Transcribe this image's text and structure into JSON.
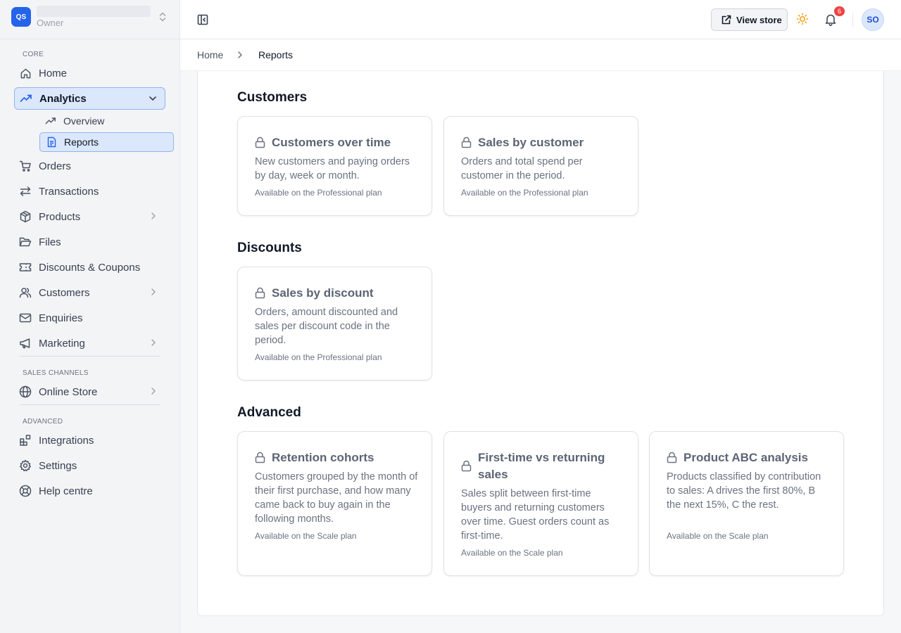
{
  "store": {
    "initials": "QS",
    "role": "Owner"
  },
  "sidebar": {
    "sections": {
      "core": "CORE",
      "sales_channels": "SALES CHANNELS",
      "advanced": "ADVANCED"
    },
    "items": {
      "home": "Home",
      "analytics": "Analytics",
      "overview": "Overview",
      "reports": "Reports",
      "orders": "Orders",
      "transactions": "Transactions",
      "products": "Products",
      "files": "Files",
      "discounts": "Discounts & Coupons",
      "customers": "Customers",
      "enquiries": "Enquiries",
      "marketing": "Marketing",
      "online_store": "Online Store",
      "integrations": "Integrations",
      "settings": "Settings",
      "help": "Help centre"
    }
  },
  "topbar": {
    "view_store": "View store",
    "notifications_count": "6",
    "avatar_initials": "SO"
  },
  "breadcrumb": {
    "home": "Home",
    "current": "Reports"
  },
  "sections": {
    "customers": {
      "title": "Customers",
      "cards": [
        {
          "title": "Customers over time",
          "desc": "New customers and paying orders by day, week or month.",
          "plan": "Available on the Professional plan"
        },
        {
          "title": "Sales by customer",
          "desc": "Orders and total spend per customer in the period.",
          "plan": "Available on the Professional plan"
        }
      ]
    },
    "discounts": {
      "title": "Discounts",
      "cards": [
        {
          "title": "Sales by discount",
          "desc": "Orders, amount discounted and sales per discount code in the period.",
          "plan": "Available on the Professional plan"
        }
      ]
    },
    "advanced": {
      "title": "Advanced",
      "cards": [
        {
          "title": "Retention cohorts",
          "desc": "Customers grouped by the month of their first purchase, and how many came back to buy again in the following months.",
          "plan": "Available on the Scale plan"
        },
        {
          "title": "First-time vs returning sales",
          "desc": "Sales split between first-time buyers and returning customers over time. Guest orders count as first-time.",
          "plan": "Available on the Scale plan"
        },
        {
          "title": "Product ABC analysis",
          "desc": "Products classified by contribution to sales: A drives the first 80%, B the next 15%, C the rest.",
          "plan": "Available on the Scale plan"
        }
      ]
    }
  },
  "colors": {
    "accent": "#2563eb",
    "active_bg": "#dbe7fb",
    "badge": "#ef4444",
    "theme_icon": "#f59e0b"
  }
}
